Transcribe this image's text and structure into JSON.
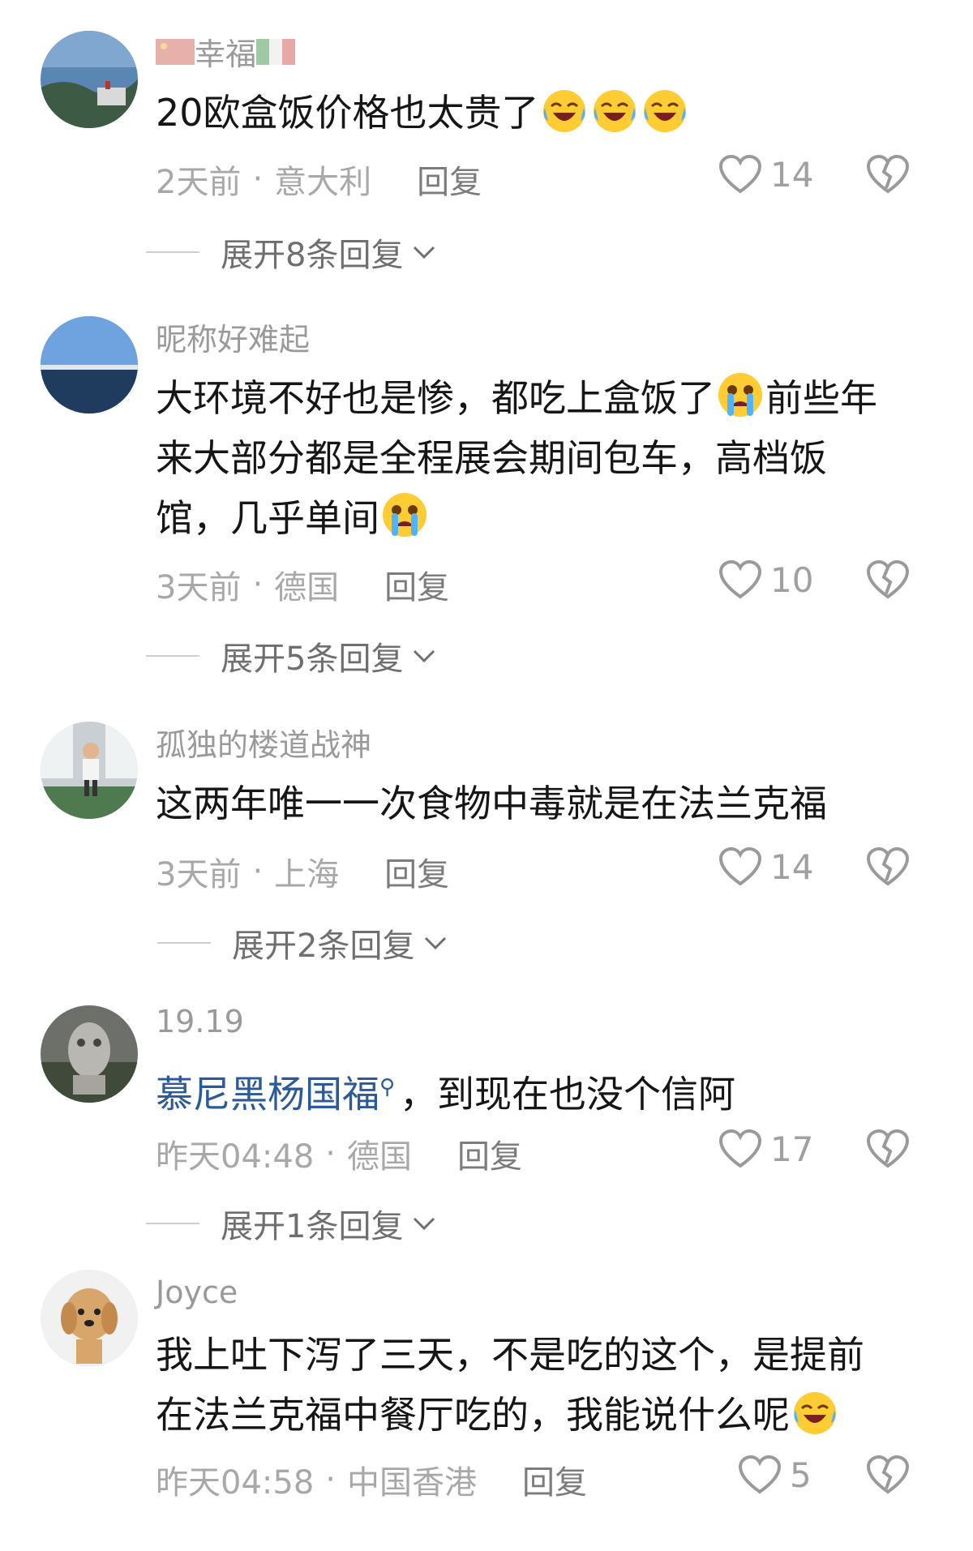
{
  "comments": [
    {
      "username": "幸福",
      "username_flags": [
        "china-flag-icon",
        "italy-flag-icon"
      ],
      "body": "20欧盒饭价格也太贵了",
      "body_emojis": [
        "laugh-cry-emoji",
        "laugh-cry-emoji",
        "laugh-cry-emoji"
      ],
      "time": "2天前",
      "location": "意大利",
      "reply_label": "回复",
      "likes": "14",
      "expand_label": "展开8条回复"
    },
    {
      "username": "昵称好难起",
      "body_lines": [
        "大环境不好也是惨，都吃上盒饭了",
        "前些年",
        "来大部分都是全程展会期间包车，高档饭",
        "馆，几乎单间"
      ],
      "time": "3天前",
      "location": "德国",
      "reply_label": "回复",
      "likes": "10",
      "expand_label": "展开5条回复"
    },
    {
      "username": "孤独的楼道战神",
      "body": "这两年唯一一次食物中毒就是在法兰克福",
      "time": "3天前",
      "location": "上海",
      "reply_label": "回复",
      "likes": "14",
      "expand_label": "展开2条回复"
    },
    {
      "username": "19.19",
      "mention": "慕尼黑杨国福",
      "body": "，到现在也没个信阿",
      "time": "昨天04:48",
      "location": "德国",
      "reply_label": "回复",
      "likes": "17",
      "expand_label": "展开1条回复"
    },
    {
      "username": "Joyce",
      "body_lines": [
        "我上吐下泻了三天，不是吃的这个，是提前",
        "在法兰克福中餐厅吃的，我能说什么呢"
      ],
      "time": "昨天04:58",
      "location": "中国香港",
      "reply_label": "回复",
      "likes": "5"
    }
  ],
  "separator": "·",
  "colors": {
    "mention": "#2a5a9a",
    "muted": "#a8a8a8",
    "text": "#161616"
  }
}
